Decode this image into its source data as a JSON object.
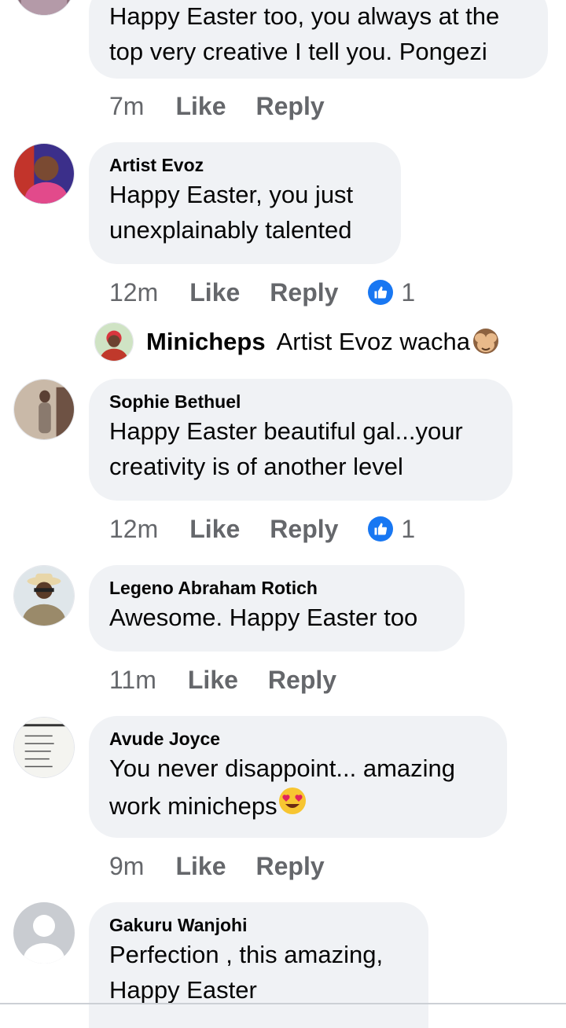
{
  "comments": [
    {
      "text_lines": [
        "Happy Easter too, you always at the",
        "top very creative I tell you. Pongezi"
      ],
      "time": "7m",
      "like": "Like",
      "reply": "Reply"
    },
    {
      "name": "Artist Evoz",
      "text_lines": [
        "Happy Easter, you just",
        "unexplainably talented"
      ],
      "time": "12m",
      "like": "Like",
      "reply": "Reply",
      "reactions": "1"
    },
    {
      "name": "Sophie Bethuel",
      "text_lines": [
        "Happy Easter beautiful gal...your",
        "creativity is of another level"
      ],
      "time": "12m",
      "like": "Like",
      "reply": "Reply",
      "reactions": "1"
    },
    {
      "name": "Legeno Abraham Rotich",
      "text_lines": [
        "Awesome. Happy Easter too"
      ],
      "time": "11m",
      "like": "Like",
      "reply": "Reply"
    },
    {
      "name": "Avude Joyce",
      "text_lines": [
        "You never disappoint... amazing",
        "work minicheps"
      ],
      "time": "9m",
      "like": "Like",
      "reply": "Reply"
    },
    {
      "name": "Gakuru Wanjohi",
      "text_lines": [
        "Perfection , this amazing,",
        "Happy Easter"
      ]
    }
  ],
  "reply_preview": {
    "name": "Minicheps",
    "text": "Artist Evoz wacha"
  },
  "icons": {
    "reaction": "like-thumb-icon",
    "see_no_evil": "see-no-evil-monkey-emoji",
    "heart_eyes": "heart-eyes-emoji"
  },
  "colors": {
    "bubble": "#f0f2f5",
    "meta": "#65676b",
    "like_blue": "#1877f2"
  }
}
